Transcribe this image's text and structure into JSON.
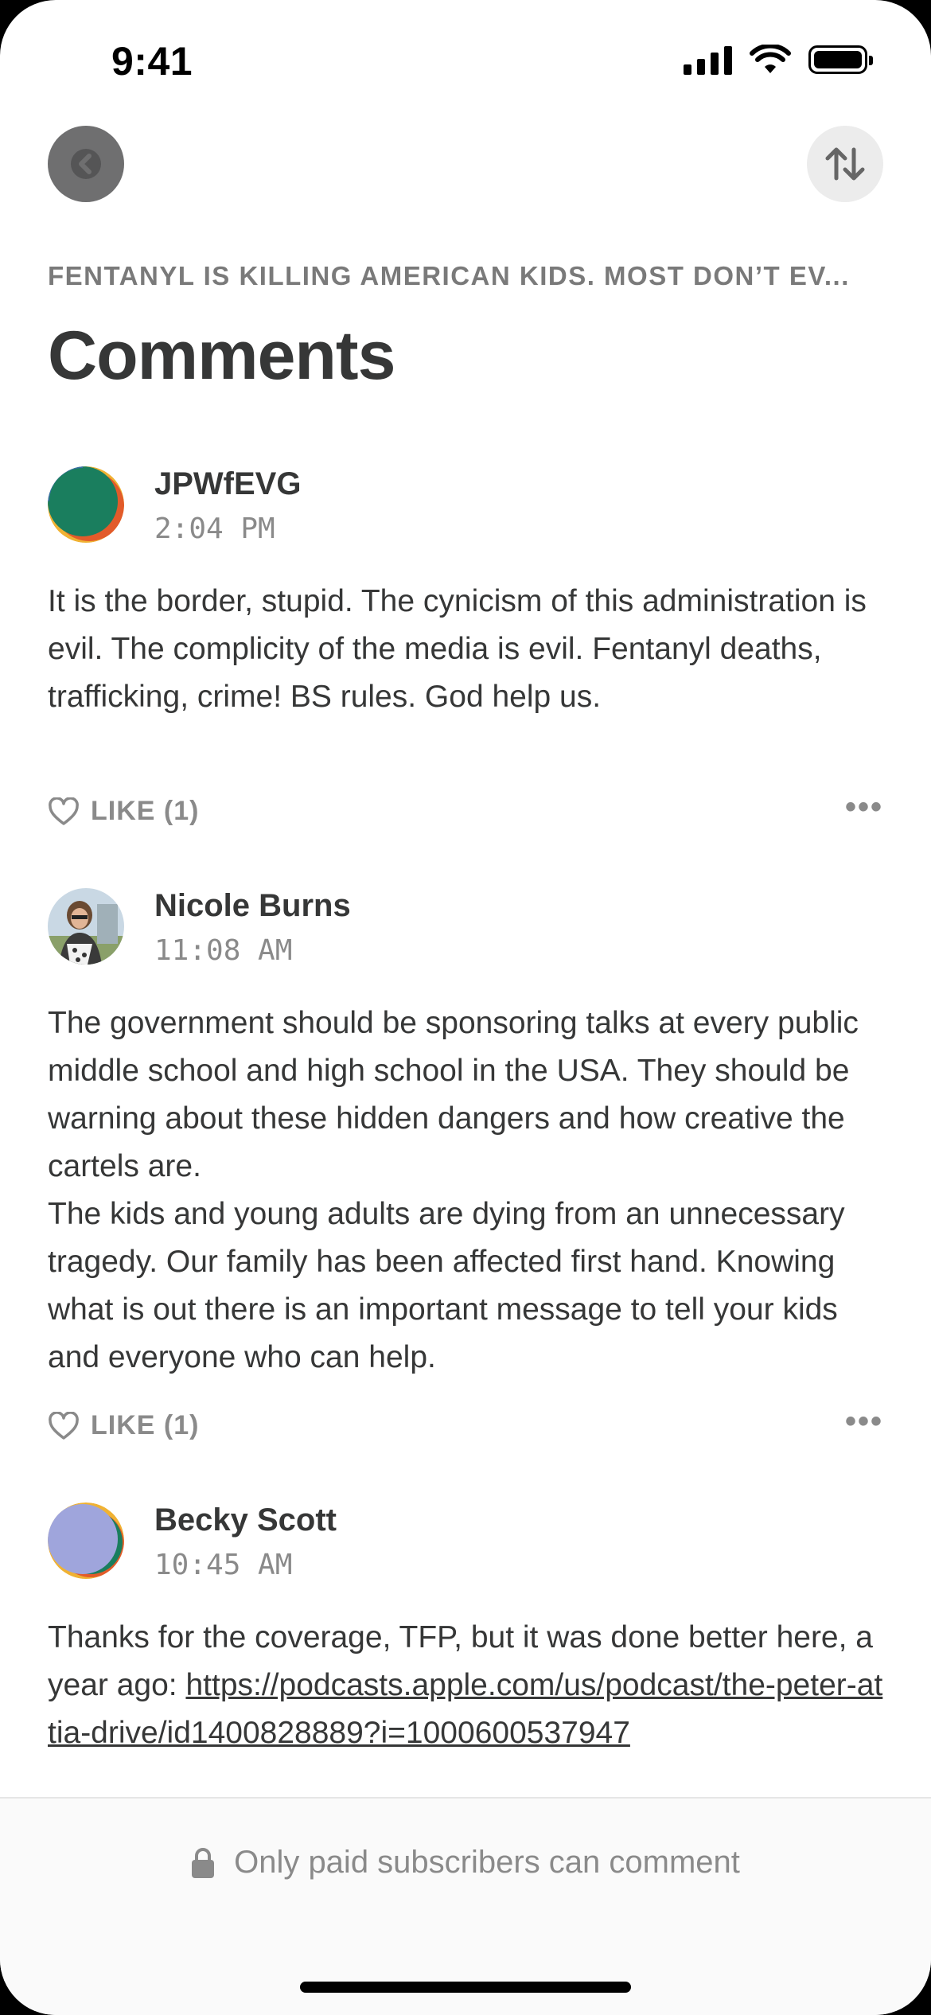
{
  "status_bar": {
    "time": "9:41"
  },
  "header": {
    "post_title": "FENTANYL IS KILLING AMERICAN KIDS. MOST DON’T EV...",
    "page_title": "Comments"
  },
  "comments": [
    {
      "author": "JPWfEVG",
      "time": "2:04 PM",
      "text": "It is the border, stupid.  The cynicism of this administration is evil. The complicity of the media is evil.  Fentanyl deaths, trafficking, crime! BS rules. God help us.",
      "like_label": "LIKE (1)"
    },
    {
      "author": "Nicole Burns",
      "time": "11:08 AM",
      "text_lines": [
        "The government should be sponsoring talks at every public middle school and high school in the USA. They should be warning about these hidden dangers and how creative the cartels are.",
        "The kids and young adults are dying from an unnecessary tragedy. Our family has been affected first hand. Knowing what is out there is an important message to tell your kids and everyone who can help."
      ],
      "like_label": "LIKE (1)"
    },
    {
      "author": "Becky Scott",
      "time": "10:45 AM",
      "text": "Thanks for the coverage, TFP, but it was done better here, a year ago:",
      "link": "https://podcasts.apple.com/us/podcast/the-peter-attia-drive/id1400828889?i=1000600537947"
    }
  ],
  "footer": {
    "message": "Only paid subscribers can comment"
  },
  "colors": {
    "text": "#363737",
    "muted": "#8a8a8a",
    "back_button": "#6f6f70",
    "sort_button": "#ececec"
  }
}
